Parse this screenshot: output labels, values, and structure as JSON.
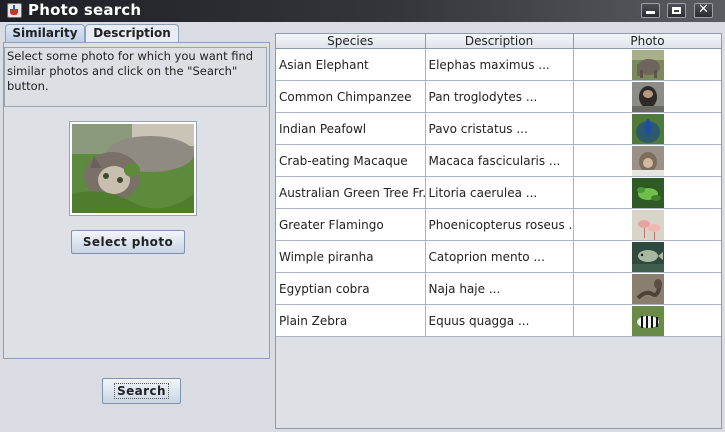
{
  "window": {
    "title": "Photo search"
  },
  "tabs": [
    {
      "label": "Similarity",
      "active": true
    },
    {
      "label": "Description",
      "active": false
    }
  ],
  "similarity": {
    "instructions": "Select some photo for which you want find similar photos and click on the \"Search\" button.",
    "select_button": "Select photo",
    "search_button": "Search"
  },
  "table": {
    "columns": [
      "Species",
      "Description",
      "Photo"
    ],
    "rows": [
      {
        "species": "Asian Elephant",
        "description": "Elephas maximus ...",
        "thumb": "elephant"
      },
      {
        "species": "Common Chimpanzee",
        "description": "Pan troglodytes ...",
        "thumb": "chimpanzee"
      },
      {
        "species": "Indian Peafowl",
        "description": "Pavo cristatus ...",
        "thumb": "peafowl"
      },
      {
        "species": "Crab-eating Macaque",
        "description": "Macaca fascicularis ...",
        "thumb": "macaque"
      },
      {
        "species": "Australian Green Tree Fr...",
        "description": "Litoria caerulea ...",
        "thumb": "frog"
      },
      {
        "species": "Greater Flamingo",
        "description": "Phoenicopterus roseus ...",
        "thumb": "flamingo"
      },
      {
        "species": "Wimple piranha",
        "description": "Catoprion mento ...",
        "thumb": "piranha"
      },
      {
        "species": "Egyptian cobra",
        "description": "Naja haje ...",
        "thumb": "cobra"
      },
      {
        "species": "Plain Zebra",
        "description": "Equus quagga ...",
        "thumb": "zebra"
      }
    ]
  }
}
